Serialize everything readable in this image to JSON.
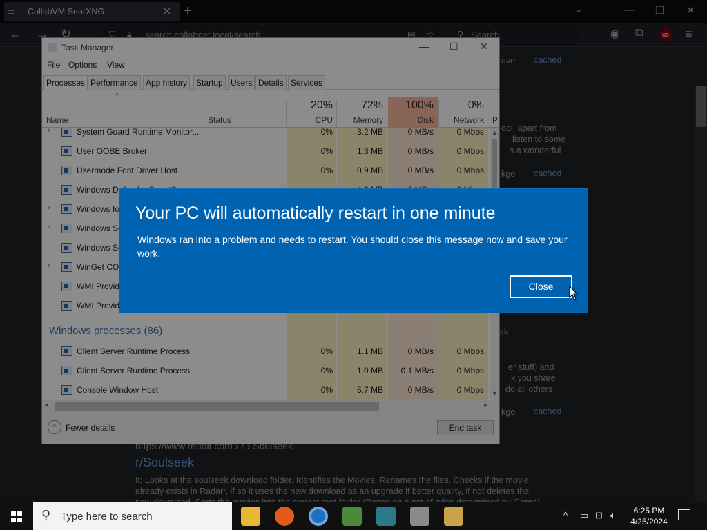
{
  "browser": {
    "tab_title": "CollabVM SearXNG",
    "url": "search.collabnet.local/search",
    "search_placeholder": "Search",
    "page": {
      "snippet_a": "ave",
      "cached_1": "cached",
      "frag_1": "ool, apart from",
      "frag_2": "listen to some",
      "frag_3": "s a wonderful",
      "frag_4": "kgo",
      "cached_2": "cached",
      "frag_5": "ek",
      "frag_6": "er stuff) and",
      "frag_7": "k you share",
      "frag_8": "do all others",
      "frag_9": "kgo",
      "cached_3": "cached",
      "result_url": "https://www.reddit.com › r › Soulseek",
      "result_title": "r/Soulseek",
      "result_text_1": "It; Looks at the soulseek download folder. Identifies the Movies, Renames the files. Checks if the movie",
      "result_text_2": "already exists in Radarr, if so it uses the new download as an upgrade if better quality, if not deletes the",
      "result_text_3": "new download. Sorts the movies into the correct root folder (Based on a set of rules determined by Genre)"
    }
  },
  "taskmanager": {
    "title": "Task Manager",
    "menu": [
      "File",
      "Options",
      "View"
    ],
    "tabs": [
      "Processes",
      "Performance",
      "App history",
      "Startup",
      "Users",
      "Details",
      "Services"
    ],
    "columns": {
      "name": "Name",
      "status": "Status",
      "cpu_pct": "20%",
      "cpu": "CPU",
      "mem_pct": "72%",
      "mem": "Memory",
      "disk_pct": "100%",
      "disk": "Disk",
      "net_pct": "0%",
      "net": "Network",
      "p": "P"
    },
    "rows": [
      {
        "name": "System Guard Runtime Monitor...",
        "cpu": "0%",
        "mem": "3.2 MB",
        "disk": "0 MB/s",
        "net": "0 Mbps"
      },
      {
        "name": "User OOBE Broker",
        "cpu": "0%",
        "mem": "1.3 MB",
        "disk": "0 MB/s",
        "net": "0 Mbps"
      },
      {
        "name": "Usermode Font Driver Host",
        "cpu": "0%",
        "mem": "0.9 MB",
        "disk": "0 MB/s",
        "net": "0 Mbps"
      },
      {
        "name": "Windows Defender SmartScreen",
        "cpu": "",
        "mem": "4.6 MB",
        "disk": "0 MB/s",
        "net": "0 Mbps"
      },
      {
        "name": "Windows Io",
        "cpu": "",
        "mem": "",
        "disk": "",
        "net": ""
      },
      {
        "name": "Windows Se",
        "cpu": "",
        "mem": "",
        "disk": "",
        "net": ""
      },
      {
        "name": "Windows Se",
        "cpu": "",
        "mem": "",
        "disk": "",
        "net": ""
      },
      {
        "name": "WinGet CO",
        "cpu": "",
        "mem": "",
        "disk": "",
        "net": ""
      },
      {
        "name": "WMI Provid",
        "cpu": "",
        "mem": "",
        "disk": "",
        "net": ""
      },
      {
        "name": "WMI Provid",
        "cpu": "",
        "mem": "",
        "disk": "",
        "net": ""
      }
    ],
    "group": "Windows processes (86)",
    "rows2": [
      {
        "name": "Client Server Runtime Process",
        "cpu": "0%",
        "mem": "1.1 MB",
        "disk": "0 MB/s",
        "net": "0 Mbps"
      },
      {
        "name": "Client Server Runtime Process",
        "cpu": "0%",
        "mem": "1.0 MB",
        "disk": "0.1 MB/s",
        "net": "0 Mbps"
      },
      {
        "name": "Console Window Host",
        "cpu": "0%",
        "mem": "5.7 MB",
        "disk": "0 MB/s",
        "net": "0 Mbps"
      }
    ],
    "fewer": "Fewer details",
    "endtask": "End task"
  },
  "dialog": {
    "title": "Your PC will automatically restart in one minute",
    "message": "Windows ran into a problem and needs to restart. You should close this message now and save your work.",
    "button": "Close"
  },
  "taskbar": {
    "search": "Type here to search",
    "time": "6:25 PM",
    "date": "4/25/2024"
  }
}
